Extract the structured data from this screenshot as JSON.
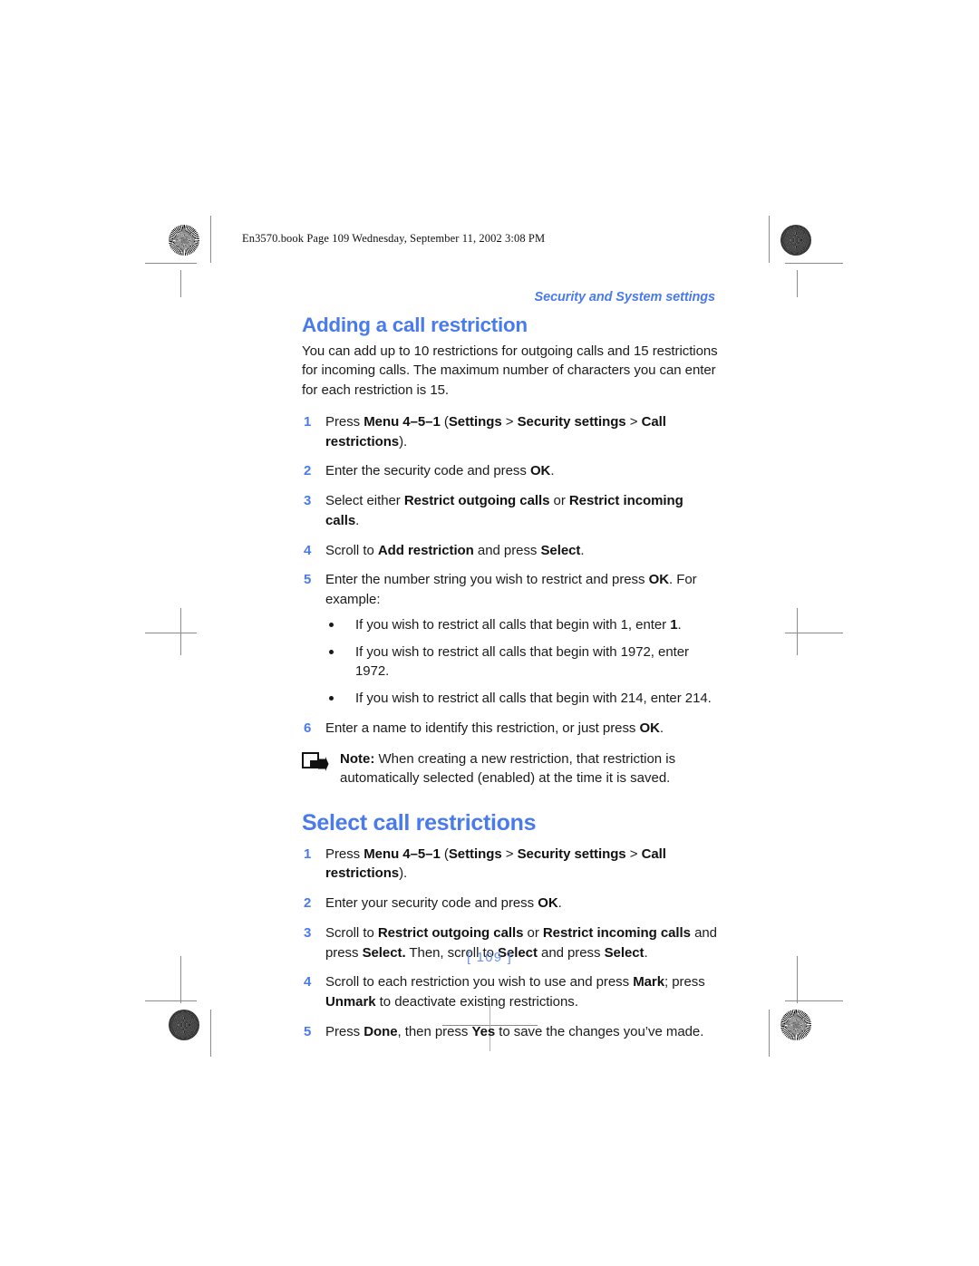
{
  "document": {
    "filestamp": "En3570.book  Page 109  Wednesday, September 11, 2002  3:08 PM",
    "running_head": "Security and System settings",
    "folio": "[ 109 ]",
    "page_number": "109",
    "accent_color": "#4a7bec",
    "folio_color": "#6b93f2",
    "body_color": "#1b1b1b"
  },
  "sections": [
    {
      "heading": "Adding a call restriction",
      "intro": "You can add up to 10 restrictions for outgoing calls and 15 restrictions for incoming calls. The maximum number of characters you can enter for each restriction is 15.",
      "steps": [
        {
          "num": "1",
          "text": "Press Menu 4–5–1 (Settings > Security settings > Call restrictions)."
        },
        {
          "num": "2",
          "text": "Enter the security code and press OK."
        },
        {
          "num": "3",
          "text": "Select either Restrict outgoing calls or Restrict incoming calls."
        },
        {
          "num": "4",
          "text": "Scroll to Add restriction and press Select."
        },
        {
          "num": "5",
          "text": "Enter the number string you wish to restrict and press OK. For example:"
        },
        {
          "num": "6",
          "text": "Enter a name to identify this restriction, or just press OK."
        }
      ],
      "bullets": [
        "If you wish to restrict all calls that begin with 1, enter 1.",
        "If you wish to restrict all calls that begin with 1972, enter 1972.",
        "If you wish to restrict all calls that begin with 214, enter 214."
      ],
      "note": {
        "icon": "note-arrow-icon",
        "label": "Note:",
        "text": "When creating a new restriction, that restriction is automatically selected (enabled) at the time it is saved."
      }
    },
    {
      "heading": "Select call restrictions",
      "steps": [
        {
          "num": "1",
          "text": "Press Menu 4–5–1 (Settings > Security settings > Call restrictions)."
        },
        {
          "num": "2",
          "text": "Enter your security code and press OK."
        },
        {
          "num": "3",
          "text": "Scroll to Restrict outgoing calls or Restrict incoming calls and press Select. Then, scroll to Select and press Select."
        },
        {
          "num": "4",
          "text": "Scroll to each restriction you wish to use and press Mark; press Unmark to deactivate existing restrictions."
        },
        {
          "num": "5",
          "text": "Press Done, then press Yes to save the changes you’ve made."
        }
      ]
    }
  ],
  "print_marks": {
    "registration_icon": "registration-crosshair-icon",
    "star_target_icon": "star-density-target-icon",
    "density_patch_icon": "density-patch-icon",
    "trim_line": "trim-line"
  }
}
